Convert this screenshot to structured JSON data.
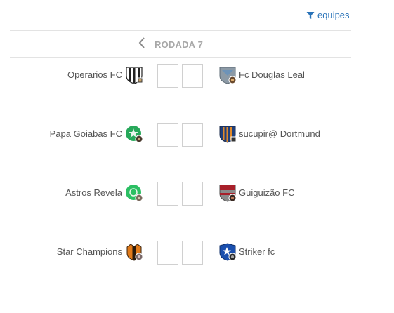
{
  "filter": {
    "label": "equipes",
    "icon": "funnel-icon"
  },
  "round": {
    "label": "RODADA 7",
    "prev_icon": "chevron-left-icon"
  },
  "matches": [
    {
      "home": {
        "name": "Operarios FC",
        "crest": "striped-shield-crest-icon"
      },
      "away": {
        "name": "Fc Douglas Leal",
        "crest": "gray-shield-crest-icon"
      },
      "home_score": "",
      "away_score": ""
    },
    {
      "home": {
        "name": "Papa Goiabas FC",
        "crest": "green-star-round-crest-icon"
      },
      "away": {
        "name": "sucupir@ Dortmund",
        "crest": "blue-orange-striped-crest-icon"
      },
      "home_score": "",
      "away_score": ""
    },
    {
      "home": {
        "name": "Astros Revela",
        "crest": "green-round-crest-icon"
      },
      "away": {
        "name": "Guiguizão FC",
        "crest": "red-gray-shield-crest-icon"
      },
      "home_score": "",
      "away_score": ""
    },
    {
      "home": {
        "name": "Star Champions",
        "crest": "orange-black-crest-icon"
      },
      "away": {
        "name": "Striker fc",
        "crest": "blue-star-shield-crest-icon"
      },
      "home_score": "",
      "away_score": ""
    }
  ],
  "colors": {
    "link": "#2a73b8",
    "round_label": "#a8a8a8",
    "text": "#555555",
    "divider": "#e3e3e3"
  }
}
